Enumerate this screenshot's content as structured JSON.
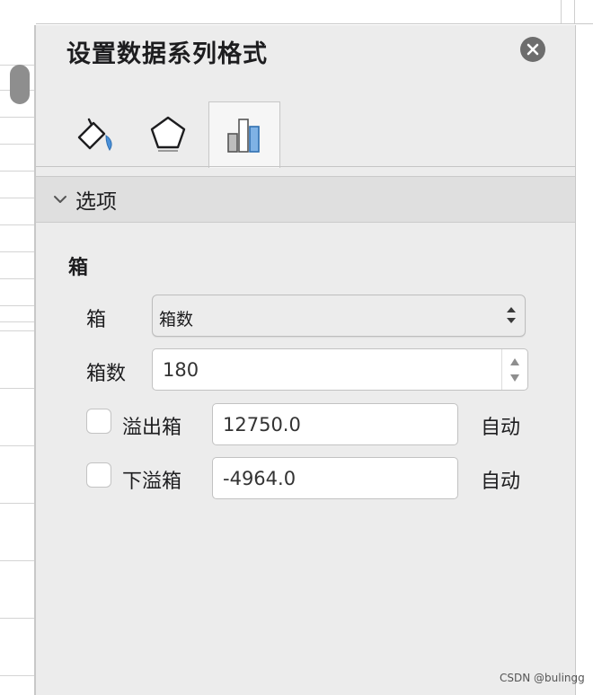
{
  "panel": {
    "title": "设置数据系列格式",
    "close_icon": "close-icon",
    "tabs": [
      {
        "name": "fill-line",
        "icon": "paint-bucket-icon",
        "active": false
      },
      {
        "name": "effects",
        "icon": "pentagon-icon",
        "active": false
      },
      {
        "name": "series-options",
        "icon": "bar-chart-icon",
        "active": true
      }
    ],
    "section": {
      "label": "选项",
      "expanded": true
    },
    "group": {
      "title": "箱",
      "bin_type": {
        "label": "箱",
        "value": "箱数"
      },
      "bin_count": {
        "label": "箱数",
        "value": "180"
      },
      "overflow": {
        "label": "溢出箱",
        "checked": false,
        "value": "12750.0",
        "auto_label": "自动"
      },
      "underflow": {
        "label": "下溢箱",
        "checked": false,
        "value": "-4964.0",
        "auto_label": "自动"
      }
    }
  },
  "watermark": "CSDN @bulingg",
  "colors": {
    "accent": "#4a90d9",
    "panel_bg": "#ececec",
    "close_bg": "#6d6d6d"
  }
}
